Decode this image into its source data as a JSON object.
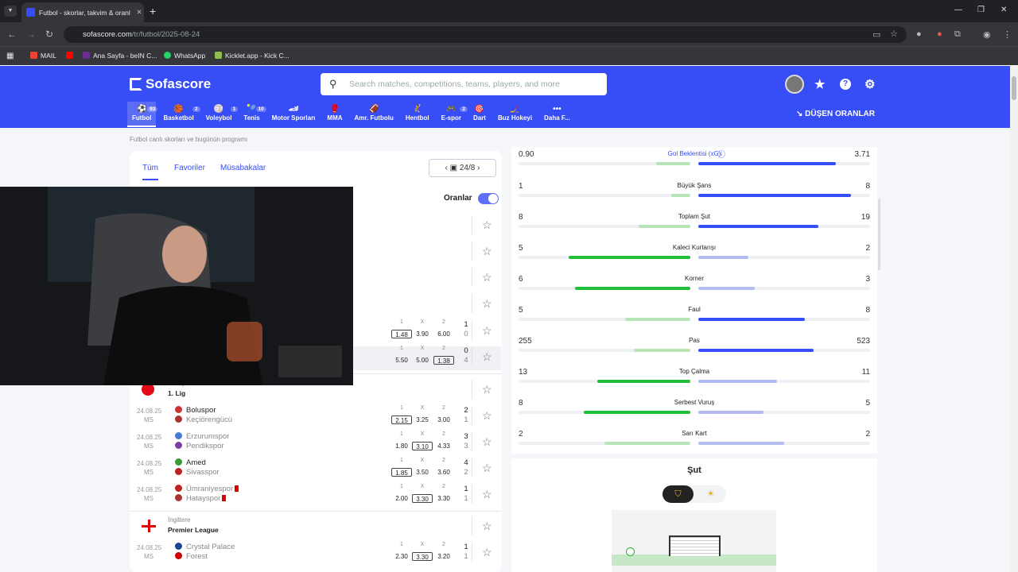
{
  "browser": {
    "tab_title": "Futbol - skorlar, takvim & oranla",
    "url_host": "sofascore.com",
    "url_path": "/tr/futbol/2025-08-24",
    "bookmarks": [
      "MAIL",
      "Ana Sayfa - beIN C...",
      "WhatsApp",
      "Kicklet.app - Kick C..."
    ]
  },
  "header": {
    "logo": "Sofascore",
    "search_placeholder": "Search matches, competitions, teams, players, and more",
    "dropping_odds": "DÜŞEN ORANLAR",
    "sports": [
      {
        "label": "Futbol",
        "count": "93",
        "icon": "⚽"
      },
      {
        "label": "Basketbol",
        "count": "2",
        "icon": "🏀"
      },
      {
        "label": "Voleybol",
        "count": "1",
        "icon": "🏐"
      },
      {
        "label": "Tenis",
        "count": "10",
        "icon": "🎾"
      },
      {
        "label": "Motor Sporları",
        "count": "",
        "icon": "🏎"
      },
      {
        "label": "MMA",
        "count": "",
        "icon": "🥊"
      },
      {
        "label": "Amr. Futbolu",
        "count": "",
        "icon": "🏈"
      },
      {
        "label": "Hentbol",
        "count": "",
        "icon": "🤾"
      },
      {
        "label": "E-spor",
        "count": "2",
        "icon": "🎮"
      },
      {
        "label": "Dart",
        "count": "",
        "icon": "🎯"
      },
      {
        "label": "Buz Hokeyi",
        "count": "",
        "icon": "🏒"
      },
      {
        "label": "Daha F...",
        "count": "",
        "icon": "•••"
      }
    ]
  },
  "breadcrumb": "Futbol canlı skorları ve bugünün programı",
  "left": {
    "tabs": [
      "Tüm",
      "Favoriler",
      "Müsabakalar"
    ],
    "date": "24/8",
    "odds_label": "Oranlar",
    "top_rows": [
      {
        "o": [
          "1.48",
          "3.90",
          "6.00"
        ],
        "boxed": 0,
        "s": [
          "1",
          "0"
        ]
      },
      {
        "o": [
          "5.50",
          "5.00",
          "1.38"
        ],
        "boxed": 2,
        "s": [
          "0",
          "4"
        ]
      }
    ],
    "league1": {
      "country": "Türkiye",
      "name": "1. Lig"
    },
    "matches": [
      {
        "date": "24.08.25",
        "status": "MS",
        "home": "Boluspor",
        "away": "Keçiörengücü",
        "o": [
          "2.15",
          "3.25",
          "3.00"
        ],
        "boxed": 0,
        "s": [
          "2",
          "1"
        ]
      },
      {
        "date": "24.08.25",
        "status": "MS",
        "home": "Erzurumspor",
        "away": "Pendikspor",
        "o": [
          "1.80",
          "3.10",
          "4.33"
        ],
        "boxed": 1,
        "s": [
          "3",
          "3"
        ]
      },
      {
        "date": "24.08.25",
        "status": "MS",
        "home": "Amed",
        "away": "Sivasspor",
        "o": [
          "1.85",
          "3.50",
          "3.60"
        ],
        "boxed": 0,
        "s": [
          "4",
          "2"
        ]
      },
      {
        "date": "24.08.25",
        "status": "MS",
        "home": "Ümraniyespor",
        "away": "Hatayspor",
        "o": [
          "2.00",
          "3.30",
          "3.30"
        ],
        "boxed": 1,
        "s": [
          "1",
          "1"
        ]
      }
    ],
    "league2": {
      "country": "İngiltere",
      "name": "Premier League"
    },
    "match5": {
      "date": "24.08.25",
      "status": "MS",
      "home": "Crystal Palace",
      "away": "Forest",
      "o": [
        "2.30",
        "3.30",
        "3.20"
      ],
      "boxed": 1,
      "s": [
        "1",
        "1"
      ]
    },
    "odds_headers": [
      "1",
      "X",
      "2"
    ]
  },
  "stats": [
    {
      "name": "Gol Beklentisi (xG)",
      "home": "0.90",
      "away": "3.71",
      "h": 0.2,
      "a": 0.8
    },
    {
      "name": "Büyük Şans",
      "home": "1",
      "away": "8",
      "h": 0.11,
      "a": 0.89
    },
    {
      "name": "Toplam Şut",
      "home": "8",
      "away": "19",
      "h": 0.3,
      "a": 0.7
    },
    {
      "name": "Kaleci Kurtarışı",
      "home": "5",
      "away": "2",
      "h": 0.71,
      "a": 0.29
    },
    {
      "name": "Korner",
      "home": "6",
      "away": "3",
      "h": 0.67,
      "a": 0.33
    },
    {
      "name": "Faul",
      "home": "5",
      "away": "8",
      "h": 0.38,
      "a": 0.62
    },
    {
      "name": "Pas",
      "home": "255",
      "away": "523",
      "h": 0.33,
      "a": 0.67
    },
    {
      "name": "Top Çalma",
      "home": "13",
      "away": "11",
      "h": 0.54,
      "a": 0.46
    },
    {
      "name": "Serbest Vuruş",
      "home": "8",
      "away": "5",
      "h": 0.62,
      "a": 0.38
    },
    {
      "name": "Sarı Kart",
      "home": "2",
      "away": "2",
      "h": 0.5,
      "a": 0.5
    }
  ],
  "shot_title": "Şut",
  "colors": {
    "brand": "#374df5",
    "home_strong": "#1fbf3a",
    "home_light": "#b8e5b8",
    "away_strong": "#374df5",
    "away_light": "#b3bbf0"
  }
}
